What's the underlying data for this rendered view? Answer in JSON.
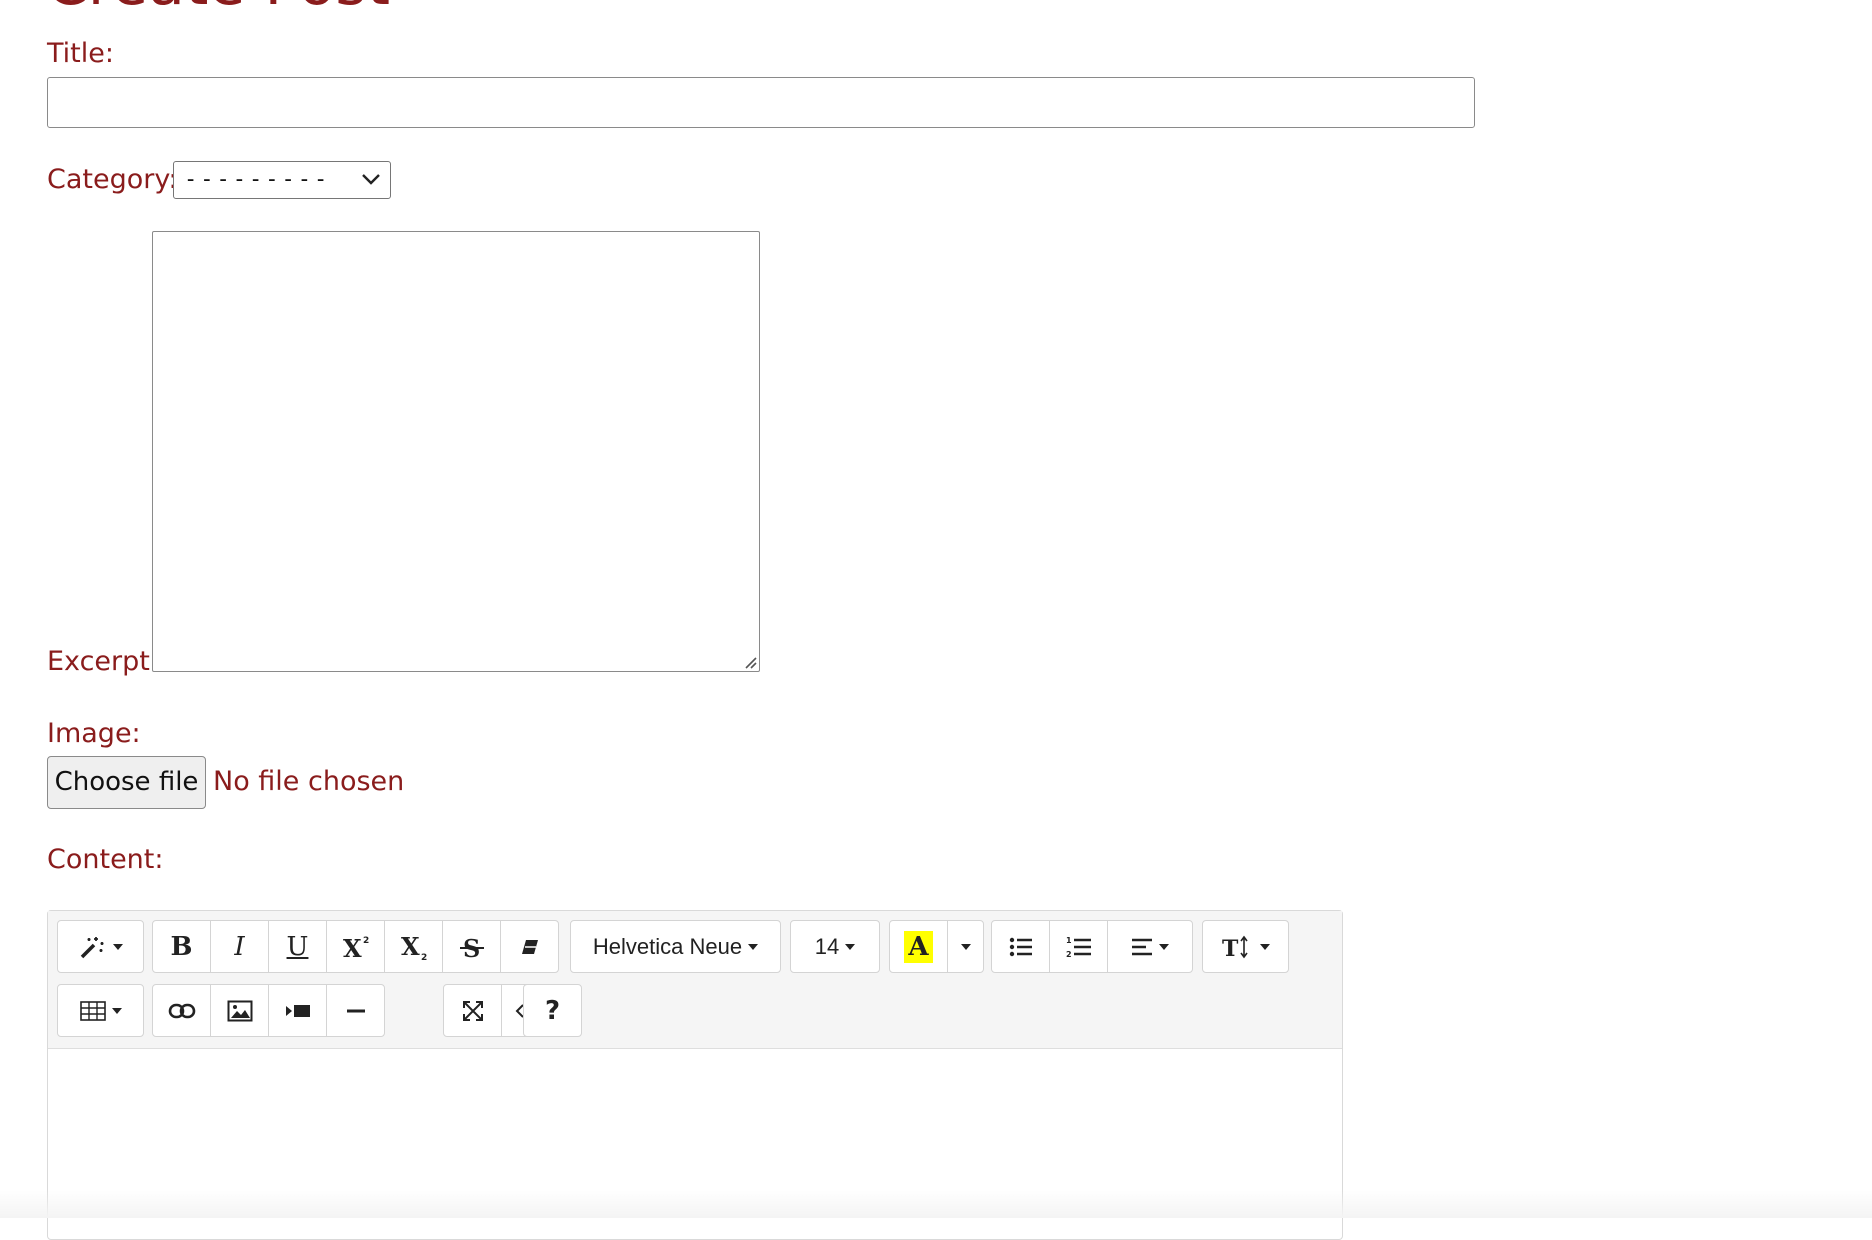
{
  "page": {
    "heading": "Create Post"
  },
  "form": {
    "title_label": "Title:",
    "title_value": "",
    "category_label": "Category:",
    "category_selected": "---------",
    "excerpt_label": "Excerpt:",
    "excerpt_value": "",
    "image_label": "Image:",
    "file_button_label": "Choose file",
    "file_status": "No file chosen",
    "content_label": "Content:"
  },
  "toolbar": {
    "font_family": "Helvetica Neue",
    "font_size": "14",
    "highlight_glyph": "A",
    "bold": "B",
    "italic": "I",
    "underline": "U",
    "help": "?"
  },
  "icons": [
    "magic-wand-icon",
    "bold-icon",
    "italic-icon",
    "underline-icon",
    "superscript-icon",
    "subscript-icon",
    "strikethrough-icon",
    "eraser-icon",
    "highlight-icon",
    "unordered-list-icon",
    "ordered-list-icon",
    "align-icon",
    "line-height-icon",
    "table-icon",
    "link-icon",
    "picture-icon",
    "video-icon",
    "horizontal-rule-icon",
    "fullscreen-icon",
    "code-view-icon",
    "help-icon"
  ],
  "colors": {
    "label": "#8a1c1c",
    "toolbar_bg": "#f5f5f5",
    "highlight": "#ffff00"
  }
}
